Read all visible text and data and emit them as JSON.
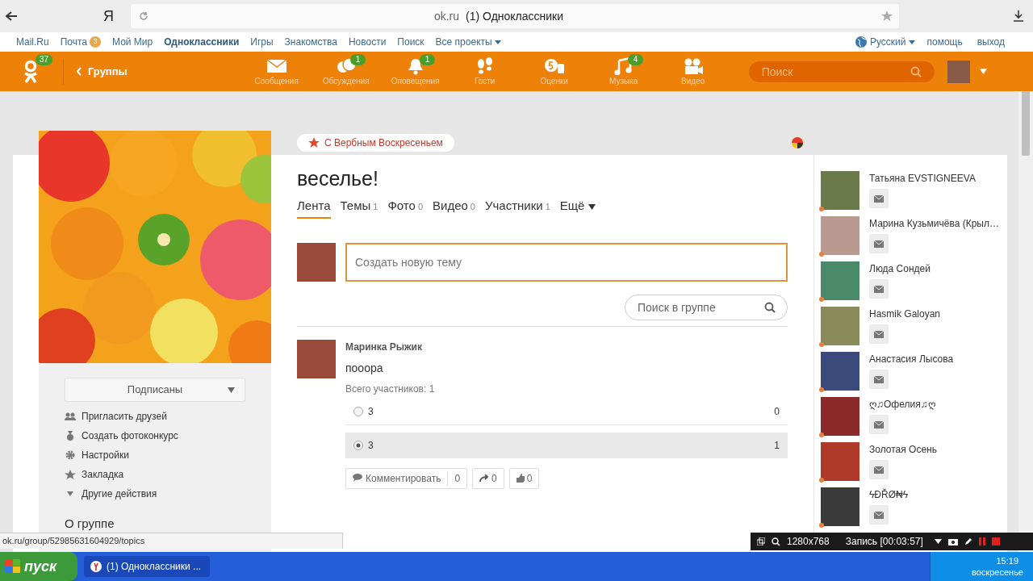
{
  "browser": {
    "logo": "Я",
    "domain": "ok.ru",
    "page_title": "(1) Одноклассники"
  },
  "portal_links": [
    {
      "label": "Mail.Ru",
      "selected": false
    },
    {
      "label": "Почта",
      "badge": "3",
      "selected": false
    },
    {
      "label": "Мой Мир",
      "selected": false
    },
    {
      "label": "Одноклассники",
      "selected": true
    },
    {
      "label": "Игры",
      "selected": false
    },
    {
      "label": "Знакомства",
      "selected": false
    },
    {
      "label": "Новости",
      "selected": false
    },
    {
      "label": "Поиск",
      "selected": false
    },
    {
      "label": "Все проекты",
      "selected": false
    }
  ],
  "portal_right": {
    "language": "Русский",
    "help": "помощь",
    "logout": "выход"
  },
  "header": {
    "logo_badge": "37",
    "back_label": "Группы",
    "search_placeholder": "Поиск",
    "nav": [
      {
        "kind": "messages",
        "label": "Сообщения"
      },
      {
        "kind": "discussions",
        "label": "Обсуждения",
        "badge": "1"
      },
      {
        "kind": "notifications",
        "label": "Оповещения",
        "badge": "1"
      },
      {
        "kind": "guests",
        "label": "Гости"
      },
      {
        "kind": "ratings",
        "label": "Оценки"
      },
      {
        "kind": "music",
        "label": "Музыка",
        "badge": "4"
      },
      {
        "kind": "video",
        "label": "Видео"
      }
    ]
  },
  "banner": "С Вербным Воскресеньем",
  "sidebar": {
    "subscribe_button": "Подписаны",
    "actions": [
      {
        "kind": "invite",
        "label": "Пригласить друзей"
      },
      {
        "kind": "contest",
        "label": "Создать фотоконкурс"
      },
      {
        "kind": "settings",
        "label": "Настройки"
      },
      {
        "kind": "bookmark",
        "label": "Закладка"
      },
      {
        "kind": "more",
        "label": "Другие действия"
      }
    ],
    "about_heading": "О группе"
  },
  "group": {
    "title": "веселье!",
    "tabs": [
      {
        "label": "Лента",
        "selected": true
      },
      {
        "label": "Темы",
        "count": "1",
        "selected": false
      },
      {
        "label": "Фото",
        "count": "0",
        "selected": false
      },
      {
        "label": "Видео",
        "count": "0",
        "selected": false
      },
      {
        "label": "Участники",
        "count": "1",
        "selected": false
      },
      {
        "label": "Ещё",
        "kind": "menu",
        "selected": false
      }
    ],
    "composer_placeholder": "Создать новую тему",
    "search_placeholder": "Поиск в группе"
  },
  "post": {
    "author": "Маринка Рыжик",
    "text": "пооора",
    "participants": "Всего участников: 1",
    "options": [
      {
        "label": "3",
        "votes": "0",
        "selected": false
      },
      {
        "label": "3",
        "votes": "1",
        "selected": true
      }
    ],
    "comment_label": "Комментировать",
    "comment_count": "0",
    "share_count": "0",
    "like_count": "0"
  },
  "friends": [
    {
      "name": "Татьяна EVSTIGNEEVA"
    },
    {
      "name": "Марина Кузьмичёва (Крыл…"
    },
    {
      "name": "Люда Сондей"
    },
    {
      "name": "Hasmik Galoyan"
    },
    {
      "name": "Анастасия Лысова"
    },
    {
      "name": "ღ♫Офелия♫ღ"
    },
    {
      "name": "Золотая Осень"
    },
    {
      "name": "ϟĐŘØ₦ϟ"
    }
  ],
  "status_url": "ok.ru/group/52985631604929/topics",
  "recorder": {
    "resolution": "1280x768",
    "recording": "Запись [00:03:57]"
  },
  "taskbar": {
    "start": "пуск",
    "task": "(1) Одноклассники ...",
    "time": "15:19",
    "day": "воскресенье"
  }
}
